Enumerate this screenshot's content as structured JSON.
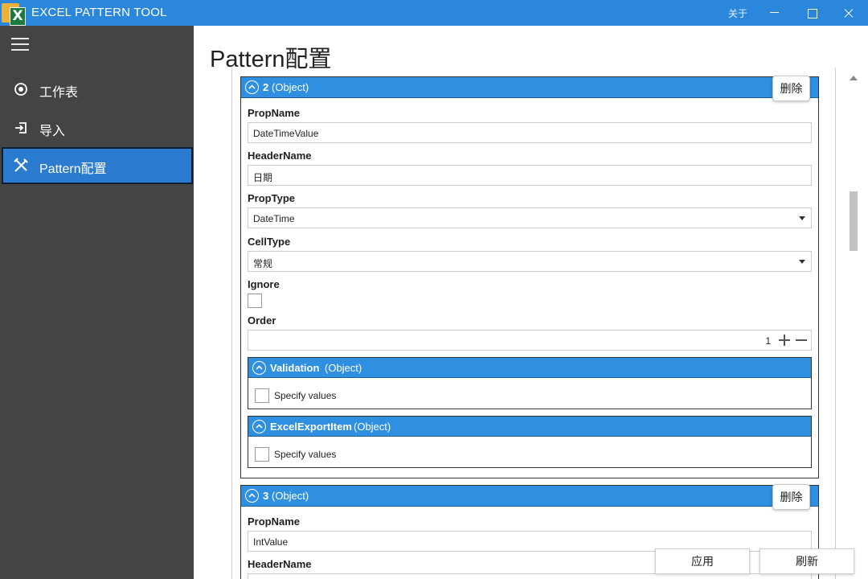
{
  "window": {
    "title": "EXCEL PATTERN TOOL",
    "about_label": "关于",
    "app_icon_letter": "X",
    "accent_color": "#2b87db"
  },
  "sidebar": {
    "items": [
      {
        "label": "工作表",
        "icon": "target-icon"
      },
      {
        "label": "导入",
        "icon": "import-icon"
      },
      {
        "label": "Pattern配置",
        "icon": "tools-icon",
        "active": true
      }
    ]
  },
  "page": {
    "title": "Pattern配置"
  },
  "objects": [
    {
      "index": "2",
      "type": "(Object)",
      "delete_label": "删除",
      "props": {
        "propname_label": "PropName",
        "propname_value": "DateTimeValue",
        "headername_label": "HeaderName",
        "headername_value": "日期",
        "proptype_label": "PropType",
        "proptype_value": "DateTime",
        "celltype_label": "CellType",
        "celltype_value": "常规",
        "ignore_label": "Ignore",
        "ignore_checked": false,
        "order_label": "Order",
        "order_value": "1"
      },
      "subobjects": [
        {
          "name": "Validation",
          "type": "(Object)",
          "specify_label": "Specify values"
        },
        {
          "name": "ExcelExportItem",
          "type": "(Object)",
          "specify_label": "Specify values"
        }
      ]
    },
    {
      "index": "3",
      "type": "(Object)",
      "delete_label": "删除",
      "props": {
        "propname_label": "PropName",
        "propname_value": "IntValue",
        "headername_label": "HeaderName"
      }
    }
  ],
  "footer": {
    "apply_label": "应用",
    "refresh_label": "刷新"
  }
}
